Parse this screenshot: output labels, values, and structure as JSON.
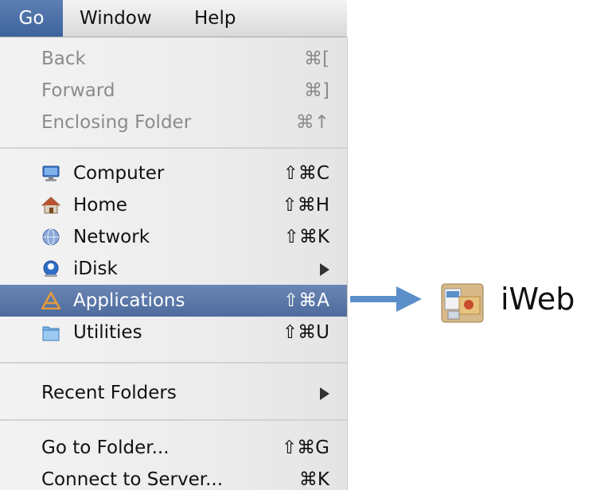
{
  "menubar": {
    "go": "Go",
    "window": "Window",
    "help": "Help"
  },
  "menu": {
    "items": [
      {
        "label": "Back",
        "shortcut": "⌘[",
        "enabled": false
      },
      {
        "label": "Forward",
        "shortcut": "⌘]",
        "enabled": false
      },
      {
        "label": "Enclosing Folder",
        "shortcut": "⌘↑",
        "enabled": false
      },
      {
        "label": "Computer",
        "shortcut": "⇧⌘C",
        "icon": "computer-icon"
      },
      {
        "label": "Home",
        "shortcut": "⇧⌘H",
        "icon": "home-icon"
      },
      {
        "label": "Network",
        "shortcut": "⇧⌘K",
        "icon": "network-icon"
      },
      {
        "label": "iDisk",
        "shortcut": "",
        "icon": "idisk-icon",
        "submenu": true
      },
      {
        "label": "Applications",
        "shortcut": "⇧⌘A",
        "icon": "applications-icon",
        "selected": true
      },
      {
        "label": "Utilities",
        "shortcut": "⇧⌘U",
        "icon": "utilities-folder-icon"
      },
      {
        "label": "Recent Folders",
        "shortcut": "",
        "submenu": true
      },
      {
        "label": "Go to Folder...",
        "shortcut": "⇧⌘G"
      },
      {
        "label": "Connect to Server...",
        "shortcut": "⌘K"
      }
    ]
  },
  "callout": {
    "arrow_color": "#5b8fc9",
    "app_icon": "iweb-icon",
    "app_label": "iWeb"
  },
  "colors": {
    "highlight": "#4d6b9d",
    "disabled_text": "#8b8b8b"
  }
}
